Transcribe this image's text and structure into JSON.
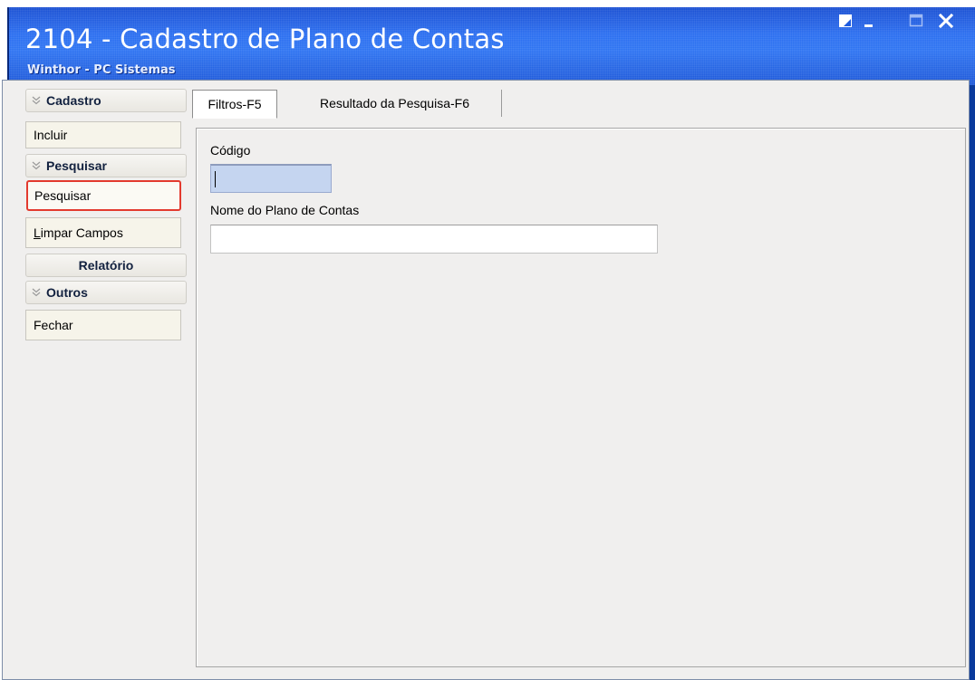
{
  "window": {
    "title": "2104 - Cadastro de Plano de Contas",
    "subtitle": "Winthor - PC Sistemas",
    "controls": [
      "restore-icon",
      "minimize-icon",
      "maximize-icon",
      "close-icon"
    ]
  },
  "sidebar": {
    "groups": [
      {
        "header": "Cadastro",
        "collapsible": true,
        "items": [
          "Incluir"
        ]
      },
      {
        "header": "Pesquisar",
        "collapsible": true,
        "items": [
          "Pesquisar",
          "Limpar Campos"
        ]
      },
      {
        "header": "Relatório",
        "collapsible": false,
        "items": []
      },
      {
        "header": "Outros",
        "collapsible": true,
        "items": [
          "Fechar"
        ]
      }
    ]
  },
  "tabs": [
    {
      "label": "Filtros-F5",
      "active": true
    },
    {
      "label": "Resultado da Pesquisa-F6",
      "active": false
    }
  ],
  "filters": {
    "codigo_label": "Código",
    "codigo_value": "",
    "nome_label": "Nome do Plano de Contas",
    "nome_value": ""
  },
  "colors": {
    "titlebar": "#2e74f2",
    "highlight_border": "#e33a2e",
    "codigo_field_bg": "#c5d5f0"
  }
}
